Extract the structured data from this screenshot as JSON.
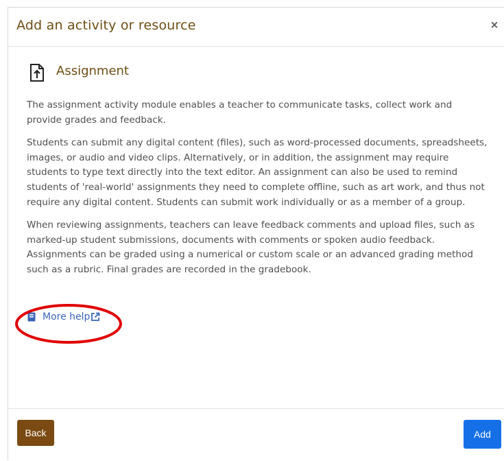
{
  "modal": {
    "title": "Add an activity or resource",
    "close_label": "×"
  },
  "module": {
    "name": "Assignment",
    "icon": "assignment-upload-icon",
    "paragraphs": [
      "The assignment activity module enables a teacher to communicate tasks, collect work and provide grades and feedback.",
      "Students can submit any digital content (files), such as word-processed documents, spreadsheets, images, or audio and video clips. Alternatively, or in addition, the assignment may require students to type text directly into the text editor. An assignment can also be used to remind students of 'real-world' assignments they need to complete offline, such as art work, and thus not require any digital content. Students can submit work individually or as a member of a group.",
      "When reviewing assignments, teachers can leave feedback comments and upload files, such as marked-up student submissions, documents with comments or spoken audio feedback. Assignments can be graded using a numerical or custom scale or an advanced grading method such as a rubric. Final grades are recorded in the gradebook."
    ],
    "more_help_label": "More help"
  },
  "footer": {
    "back_label": "Back",
    "add_label": "Add"
  },
  "colors": {
    "title": "#6e4d12",
    "back_button": "#7a4a12",
    "add_button": "#1570e8",
    "link": "#3a66b8",
    "annotation_ellipse": "#e00000"
  }
}
